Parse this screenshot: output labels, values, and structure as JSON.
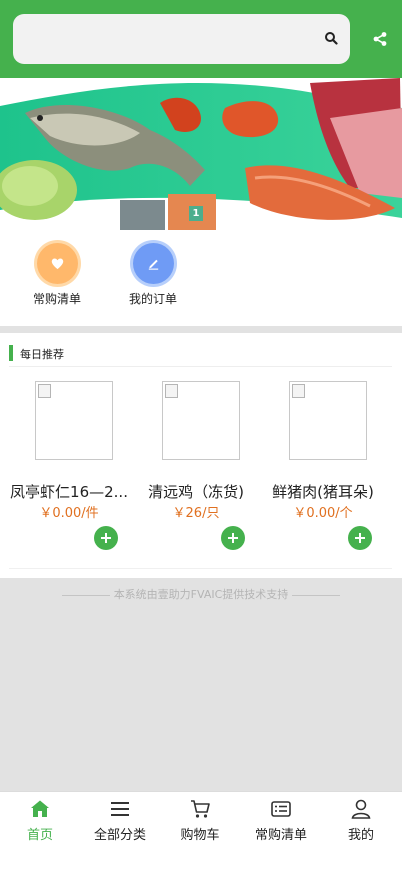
{
  "header": {
    "search_placeholder": "",
    "search_icon": "search-icon",
    "share_icon": "share-icon",
    "color": "#45b14d"
  },
  "banner": {
    "indicator": "1"
  },
  "quick_entries": [
    {
      "label": "常购清单",
      "icon": "heart-icon",
      "color": "#ffb86b"
    },
    {
      "label": "我的订单",
      "icon": "edit-icon",
      "color": "#6f9bf5"
    }
  ],
  "recommend": {
    "title": "每日推荐",
    "products": [
      {
        "name": "凤亭虾仁16—2...",
        "price": "￥0.00/件"
      },
      {
        "name": "清远鸡（冻货)",
        "price": "￥26/只"
      },
      {
        "name": "鲜猪肉(猪耳朵)",
        "price": "￥0.00/个"
      }
    ]
  },
  "footer_note": "本系统由壹助力FVAIC提供技术支持",
  "tabbar": {
    "items": [
      {
        "label": "首页",
        "icon": "home-icon",
        "active": true
      },
      {
        "label": "全部分类",
        "icon": "menu-icon",
        "active": false
      },
      {
        "label": "购物车",
        "icon": "cart-icon",
        "active": false
      },
      {
        "label": "常购清单",
        "icon": "list-icon",
        "active": false
      },
      {
        "label": "我的",
        "icon": "user-icon",
        "active": false
      }
    ],
    "active_color": "#45b14d"
  }
}
